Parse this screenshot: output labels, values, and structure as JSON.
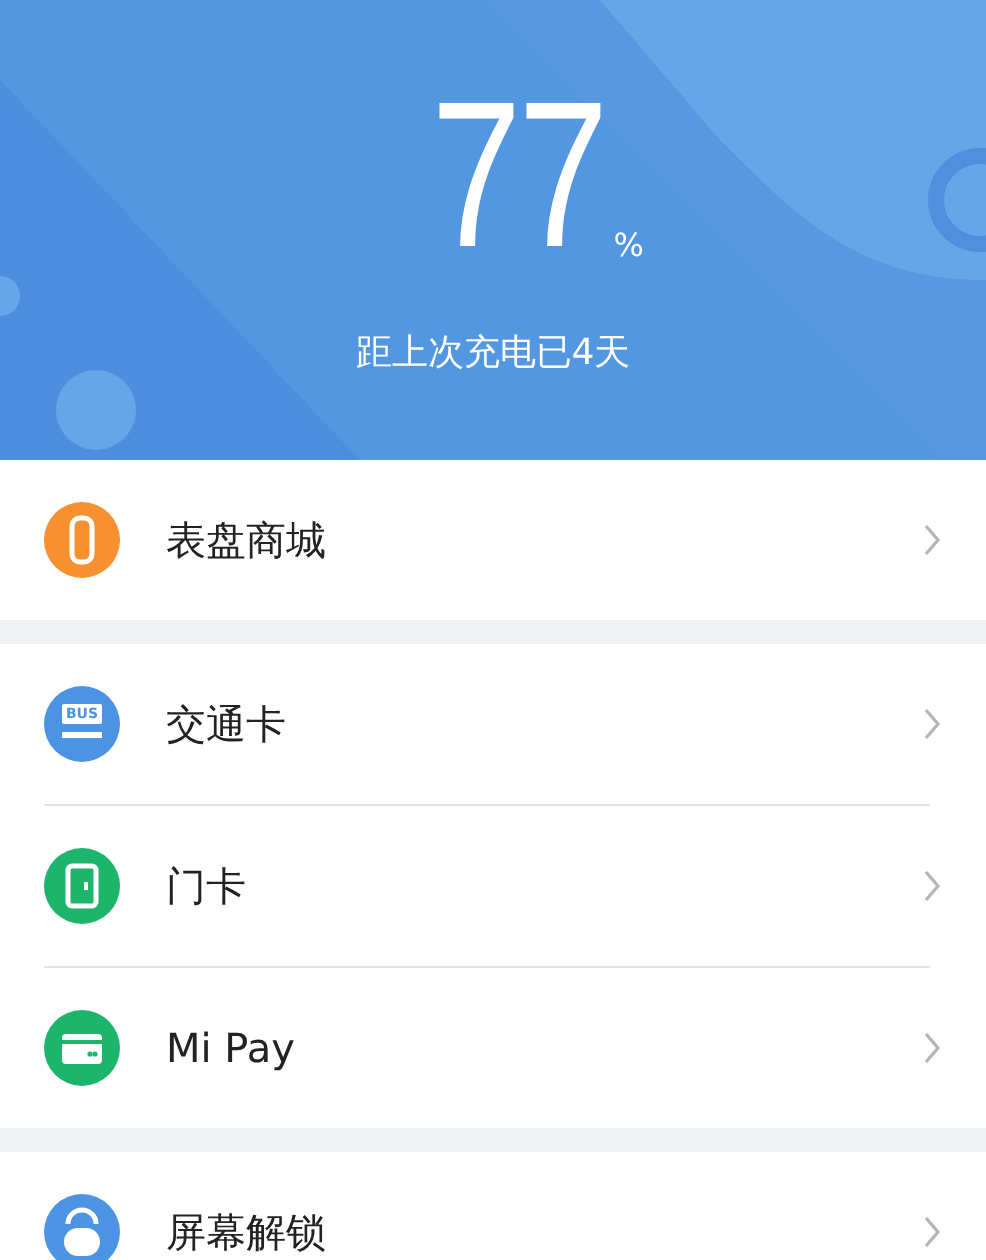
{
  "battery": {
    "value": "77",
    "unit": "%",
    "subtitle": "距上次充电已4天"
  },
  "groups": [
    {
      "items": [
        {
          "kind": "band",
          "color": "#f7912f",
          "label": "表盘商城"
        }
      ]
    },
    {
      "items": [
        {
          "kind": "bus",
          "color": "#4d93e3",
          "label": "交通卡",
          "icon_text": "BUS"
        },
        {
          "kind": "door",
          "color": "#1db56b",
          "label": "门卡"
        },
        {
          "kind": "card",
          "color": "#1db56b",
          "label": "Mi Pay"
        }
      ]
    },
    {
      "items": [
        {
          "kind": "lock",
          "color": "#4d93e3",
          "label": "屏幕解锁"
        }
      ]
    }
  ]
}
